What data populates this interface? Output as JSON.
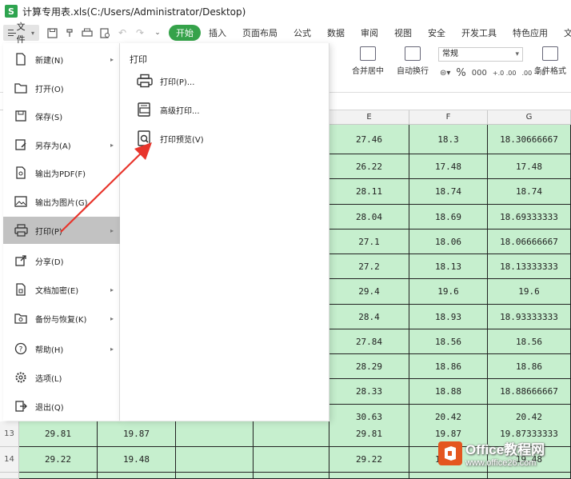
{
  "window": {
    "app_logo": "S",
    "title": "计算专用表.xls(C:/Users/Administrator/Desktop)"
  },
  "menubar": {
    "file_label": "文件",
    "tabs": [
      "开始",
      "插入",
      "页面布局",
      "公式",
      "数据",
      "审阅",
      "视图",
      "安全",
      "开发工具",
      "特色应用",
      "文档助手"
    ],
    "active_tab": "开始",
    "accent_color": "#35a24a"
  },
  "ribbon": {
    "merge_label": "合并居中",
    "wrap_label": "自动换行",
    "number_format": "常规",
    "percent": "%",
    "thousands": "000",
    "inc_decimal": "+.0 .00",
    "dec_decimal": ".00 →.0",
    "cond_format": "条件格式"
  },
  "sheet": {
    "columns": [
      "E",
      "F",
      "G"
    ],
    "rows": [
      {
        "E": "27.46",
        "F": "18.3",
        "G": "18.30666667"
      },
      {
        "E": "26.22",
        "F": "17.48",
        "G": "17.48"
      },
      {
        "E": "28.11",
        "F": "18.74",
        "G": "18.74"
      },
      {
        "E": "28.04",
        "F": "18.69",
        "G": "18.69333333"
      },
      {
        "E": "27.1",
        "F": "18.06",
        "G": "18.06666667"
      },
      {
        "E": "27.2",
        "F": "18.13",
        "G": "18.13333333"
      },
      {
        "E": "29.4",
        "F": "19.6",
        "G": "19.6"
      },
      {
        "E": "28.4",
        "F": "18.93",
        "G": "18.93333333"
      },
      {
        "E": "27.84",
        "F": "18.56",
        "G": "18.56"
      },
      {
        "E": "28.29",
        "F": "18.86",
        "G": "18.86"
      },
      {
        "E": "28.33",
        "F": "18.88",
        "G": "18.88666667"
      },
      {
        "E": "30.63",
        "F": "20.42",
        "G": "20.42"
      }
    ],
    "row13": {
      "num": "13",
      "A": "29.81",
      "B": "19.87",
      "E": "29.81",
      "F": "19.87",
      "G": "19.87333333"
    },
    "row14": {
      "num": "14",
      "A": "29.22",
      "B": "19.48",
      "E": "29.22",
      "F": "19.48",
      "G": "19.48"
    },
    "cell_color": "#c6efce"
  },
  "file_menu": {
    "items": [
      {
        "label": "新建(N)",
        "icon": "new-file-icon",
        "arrow": true
      },
      {
        "label": "打开(O)",
        "icon": "folder-open-icon",
        "arrow": false
      },
      {
        "label": "保存(S)",
        "icon": "save-icon",
        "arrow": false
      },
      {
        "label": "另存为(A)",
        "icon": "save-as-icon",
        "arrow": true
      },
      {
        "label": "输出为PDF(F)",
        "icon": "pdf-export-icon",
        "arrow": false
      },
      {
        "label": "输出为图片(G)",
        "icon": "image-export-icon",
        "arrow": false
      },
      {
        "label": "打印(P)",
        "icon": "printer-icon",
        "arrow": true,
        "active": true
      },
      {
        "label": "分享(D)",
        "icon": "share-icon",
        "arrow": false
      },
      {
        "label": "文档加密(E)",
        "icon": "lock-icon",
        "arrow": true
      },
      {
        "label": "备份与恢复(K)",
        "icon": "backup-icon",
        "arrow": true
      },
      {
        "label": "帮助(H)",
        "icon": "help-icon",
        "arrow": true
      },
      {
        "label": "选项(L)",
        "icon": "gear-icon",
        "arrow": false
      },
      {
        "label": "退出(Q)",
        "icon": "exit-icon",
        "arrow": false
      }
    ]
  },
  "print_panel": {
    "title": "打印",
    "items": [
      {
        "label": "打印(P)...",
        "icon": "printer-icon"
      },
      {
        "label": "高级打印...",
        "icon": "advanced-print-icon"
      },
      {
        "label": "打印预览(V)",
        "icon": "print-preview-icon"
      }
    ],
    "arrow_color": "#e8352c"
  },
  "watermark": {
    "title": "Office教程网",
    "url": "www.office26.com",
    "logo_color": "#e4561f"
  }
}
